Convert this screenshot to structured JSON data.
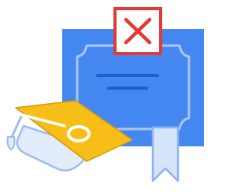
{
  "illustration": {
    "subject": "certificate-with-rejection-mark-and-graduation-cap",
    "icons": [
      "certificate-icon",
      "close-icon",
      "graduation-cap-icon",
      "ribbon-icon"
    ],
    "colors": {
      "certificate_blue": "#4487F0",
      "certificate_line": "#A9C7FA",
      "certificate_text_line": "#1F5FCC",
      "ribbon": "#D6E4FB",
      "ribbon_stroke": "#8EB2F1",
      "reject_red": "#E53935",
      "reject_bg": "#FFFFFF",
      "cap_yellow": "#F6BE17",
      "cap_dark": "#D59A07",
      "cap_base": "#E3ECFA",
      "cap_base_stroke": "#9DBCF2",
      "tassel": "#FFFFFF"
    }
  }
}
